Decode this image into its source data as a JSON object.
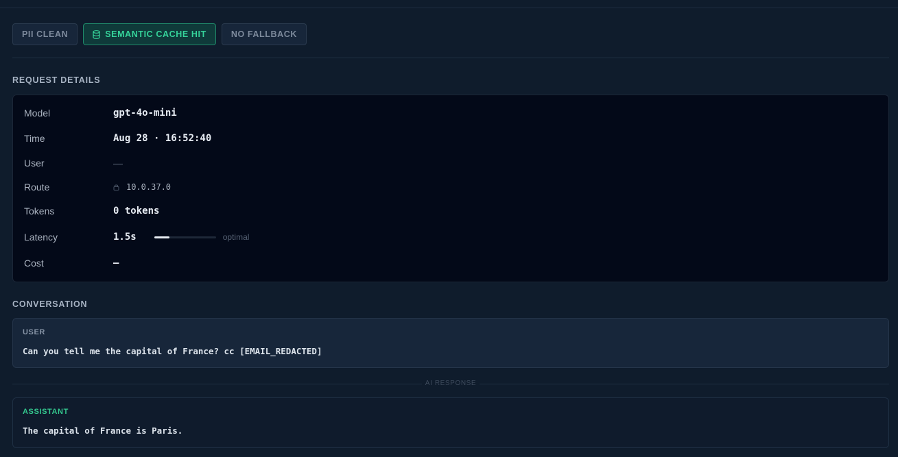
{
  "chips": [
    {
      "label": "PII CLEAN",
      "active": false
    },
    {
      "label": "SEMANTIC CACHE HIT",
      "active": true,
      "icon": "database-icon"
    },
    {
      "label": "NO FALLBACK",
      "active": false
    }
  ],
  "request_details": {
    "title": "REQUEST DETAILS",
    "model_label": "Model",
    "model_value": "gpt-4o-mini",
    "time_label": "Time",
    "time_value": "Aug 28 · 16:52:40",
    "user_label": "User",
    "user_value": "—",
    "route_label": "Route",
    "route_icon": "lock-icon",
    "route_value": "10.0.37.0",
    "tokens_label": "Tokens",
    "tokens_value": "0 tokens",
    "latency_label": "Latency",
    "latency_value": "1.5s",
    "latency_level": 0.25,
    "latency_note": "optimal",
    "cost_label": "Cost",
    "cost_value": "—"
  },
  "conversation": {
    "title": "CONVERSATION",
    "user_role": "USER",
    "user_text": "Can you tell me the capital of France? cc [EMAIL_REDACTED]",
    "separator": "AI RESPONSE",
    "assistant_role": "ASSISTANT",
    "assistant_text": "The capital of France is Paris."
  },
  "colors": {
    "accent": "#35d39a",
    "background": "#0f1c2c",
    "card": "#030918"
  }
}
